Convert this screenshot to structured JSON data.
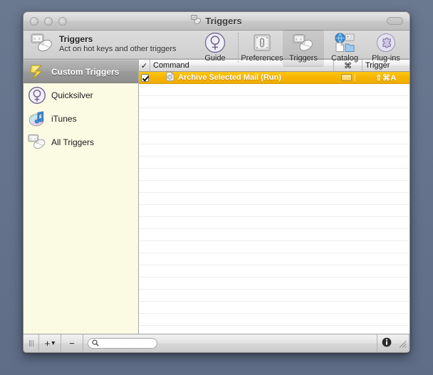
{
  "window": {
    "title": "Triggers",
    "title_icon": "triggers-icon",
    "traffic_lights": [
      "close-button",
      "minimize-button",
      "zoom-button"
    ],
    "toolbar_toggle": "toolbar-toggle-button"
  },
  "banner": {
    "icon": "triggers-icon",
    "title": "Triggers",
    "subtitle": "Act on hot keys and other triggers"
  },
  "toolbar": {
    "items": [
      {
        "label": "Guide",
        "icon": "quicksilver-guide-icon",
        "selected": false
      },
      {
        "label": "Preferences",
        "icon": "preferences-switch-icon",
        "selected": false
      },
      {
        "label": "Triggers",
        "icon": "triggers-icon",
        "selected": true
      },
      {
        "label": "Catalog",
        "icon": "catalog-icon",
        "selected": false
      },
      {
        "label": "Plug-ins",
        "icon": "plugins-puzzle-icon",
        "selected": false
      }
    ]
  },
  "sidebar": {
    "items": [
      {
        "label": "Custom Triggers",
        "icon": "lightning-bolt-icon",
        "selected": true
      },
      {
        "label": "Quicksilver",
        "icon": "quicksilver-icon",
        "selected": false
      },
      {
        "label": "iTunes",
        "icon": "itunes-icon",
        "selected": false
      },
      {
        "label": "All Triggers",
        "icon": "triggers-icon",
        "selected": false
      }
    ]
  },
  "list": {
    "columns": [
      {
        "key": "check",
        "label": "✓"
      },
      {
        "key": "command",
        "label": "Command"
      },
      {
        "key": "cmdkey",
        "label": "⌘"
      },
      {
        "key": "trigger",
        "label": "Trigger"
      }
    ],
    "rows": [
      {
        "checked": true,
        "icon": "command-document-icon",
        "command": "Archive Selected Mail (Run)",
        "cmdkey_badge": "window-badge-icon",
        "cmdkey_sep": "|",
        "trigger": "⇧⌘A",
        "selected": true
      }
    ],
    "empty_row_count": 20
  },
  "bottom_bar": {
    "grip": "drag-grip-icon",
    "add_label": "+",
    "add_arrow": "▾",
    "remove_label": "−",
    "search_placeholder": "",
    "search_value": "",
    "search_icon": "search-icon",
    "info_label": "i",
    "resize_grip": "resize-grip-icon"
  },
  "colors": {
    "desktop": "#67768f",
    "sidebar_bg": "#fbfbe4",
    "selected_row": "#f5b500",
    "window_chrome": "#d3d3d3"
  }
}
